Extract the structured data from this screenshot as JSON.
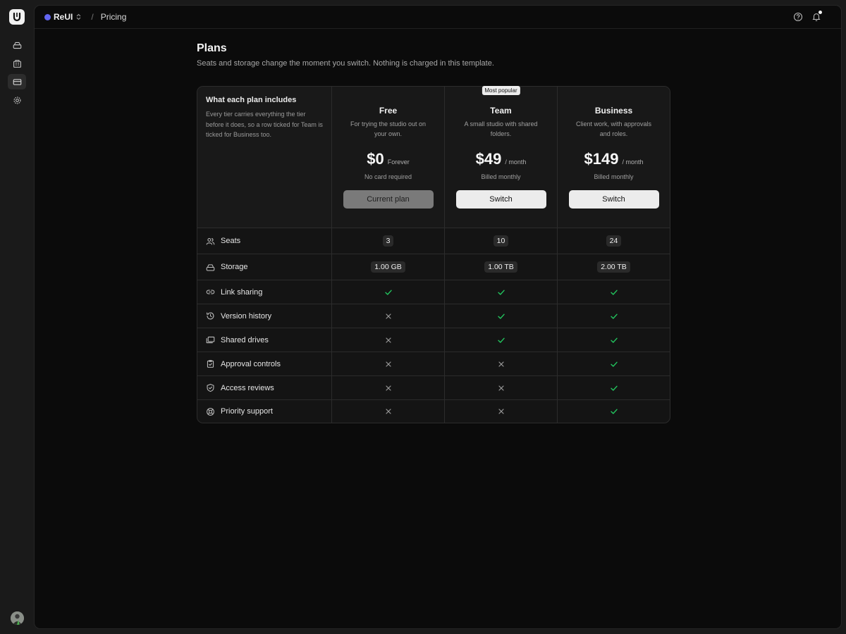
{
  "app": {
    "logo_letter": "U"
  },
  "topbar": {
    "workspace": "ReUI",
    "breadcrumb_separator": "/",
    "page": "Pricing"
  },
  "page": {
    "title": "Plans",
    "subtitle": "Seats and storage change the moment you switch. Nothing is charged in this template."
  },
  "intro": {
    "title": "What each plan includes",
    "text": "Every tier carries everything the tier before it does, so a row ticked for Team is ticked for Business too."
  },
  "plans": [
    {
      "name": "Free",
      "description": "For trying the studio out on your own.",
      "price": "$0",
      "period": "Forever",
      "billing": "No card required",
      "button": "Current plan",
      "current": true
    },
    {
      "name": "Team",
      "badge": "Most popular",
      "description": "A small studio with shared folders.",
      "price": "$49",
      "period": "/ month",
      "billing": "Billed monthly",
      "button": "Switch",
      "current": false
    },
    {
      "name": "Business",
      "description": "Client work, with approvals and roles.",
      "price": "$149",
      "period": "/ month",
      "billing": "Billed monthly",
      "button": "Switch",
      "current": false
    }
  ],
  "features": [
    {
      "label": "Seats",
      "icon": "users-icon",
      "values": [
        "3",
        "10",
        "24"
      ]
    },
    {
      "label": "Storage",
      "icon": "drive-icon",
      "values": [
        "1.00 GB",
        "1.00 TB",
        "2.00 TB"
      ]
    },
    {
      "label": "Link sharing",
      "icon": "link-icon",
      "values": [
        true,
        true,
        true
      ]
    },
    {
      "label": "Version history",
      "icon": "history-icon",
      "values": [
        false,
        true,
        true
      ]
    },
    {
      "label": "Shared drives",
      "icon": "folders-icon",
      "values": [
        false,
        true,
        true
      ]
    },
    {
      "label": "Approval controls",
      "icon": "clipboard-check-icon",
      "values": [
        false,
        false,
        true
      ]
    },
    {
      "label": "Access reviews",
      "icon": "shield-check-icon",
      "values": [
        false,
        false,
        true
      ]
    },
    {
      "label": "Priority support",
      "icon": "lifebuoy-icon",
      "values": [
        false,
        false,
        true
      ]
    }
  ],
  "colors": {
    "accent": "#6366f1",
    "check": "#22c55e",
    "cross": "#9a9a9a"
  }
}
